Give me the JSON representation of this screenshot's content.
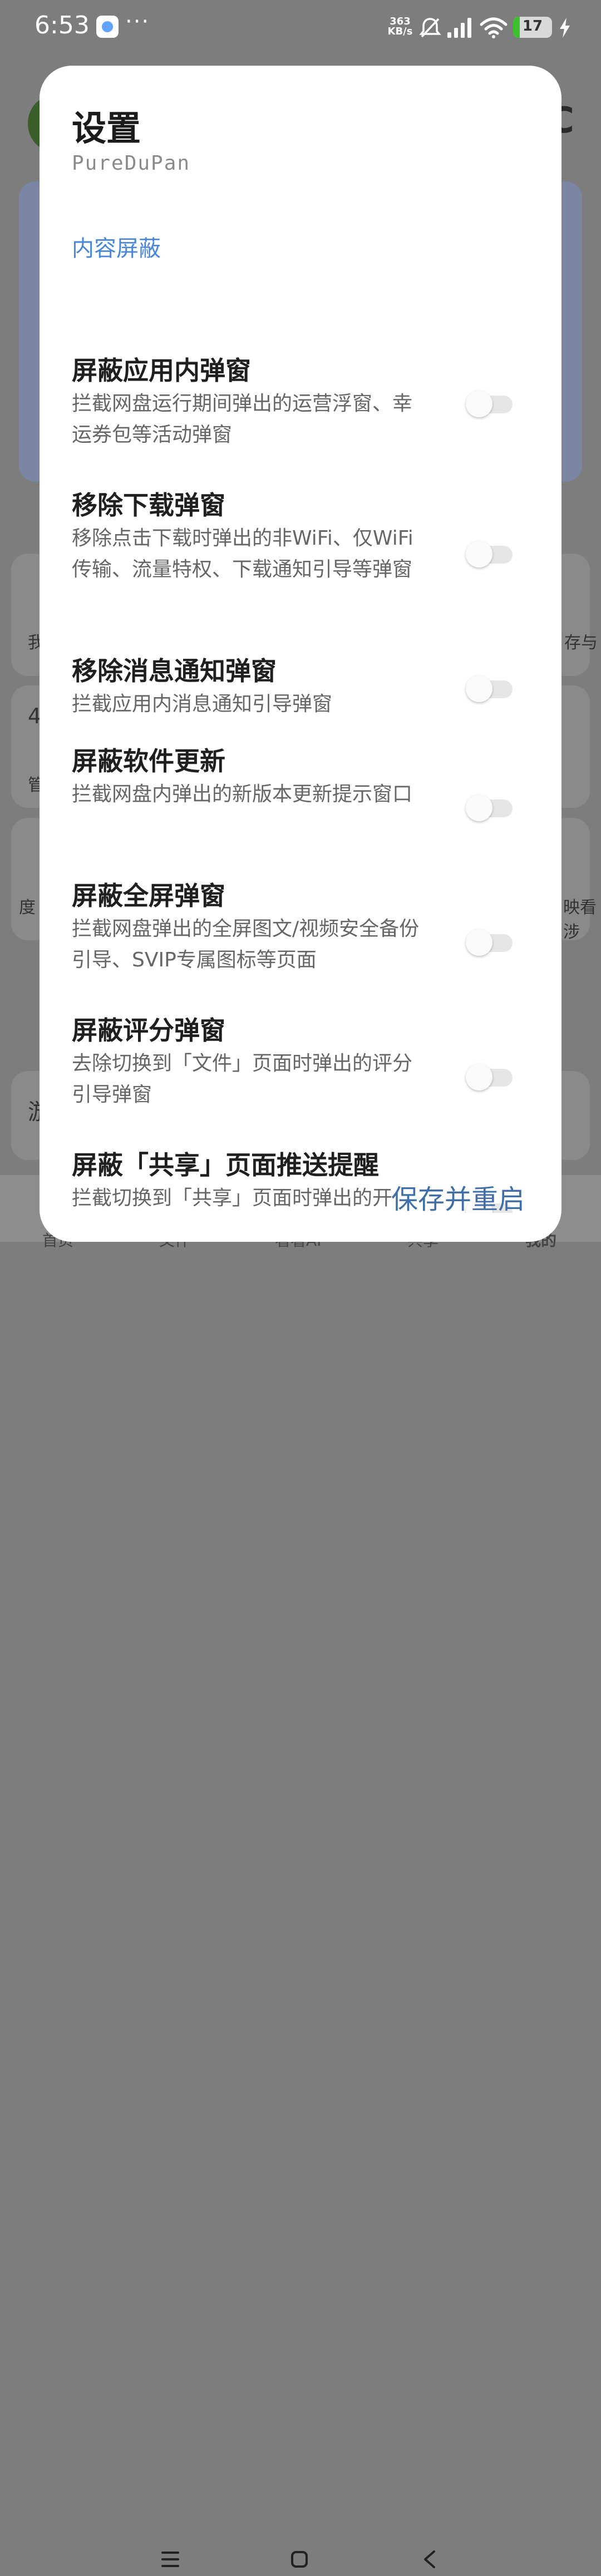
{
  "status_bar": {
    "time": "6:53",
    "more": "···",
    "speed_value": "363",
    "speed_unit": "KB/s",
    "battery": "17",
    "battery_level": 0.17
  },
  "background": {
    "title_fragment": "C",
    "left_fragment_1": "我",
    "right_fragment_1": "存与",
    "left_fragment_2": "4",
    "left_fragment_3": "管",
    "left_fragment_4": "度",
    "right_fragment_4": "映看涉",
    "left_fragment_5": "游",
    "tabs": [
      "首页",
      "文件",
      "看看AI",
      "共享",
      "我的"
    ]
  },
  "dialog": {
    "title": "设置",
    "subtitle": "PureDuPan",
    "section": "内容屏蔽",
    "items": [
      {
        "title": "屏蔽应用内弹窗",
        "desc": "拦截网盘运行期间弹出的运营浮窗、幸运券包等活动弹窗",
        "enabled": false
      },
      {
        "title": "移除下载弹窗",
        "desc": "移除点击下载时弹出的非WiFi、仅WiFi传输、流量特权、下载通知引导等弹窗",
        "enabled": false
      },
      {
        "title": "移除消息通知弹窗",
        "desc": "拦截应用内消息通知引导弹窗",
        "enabled": false
      },
      {
        "title": "屏蔽软件更新",
        "desc": "拦截网盘内弹出的新版本更新提示窗口",
        "enabled": false
      },
      {
        "title": "屏蔽全屏弹窗",
        "desc": "拦截网盘弹出的全屏图文/视频安全备份引导、SVIP专属图标等页面",
        "enabled": false
      },
      {
        "title": "屏蔽评分弹窗",
        "desc": "去除切换到「文件」页面时弹出的评分引导弹窗",
        "enabled": false
      },
      {
        "title": "屏蔽「共享」页面推送提醒",
        "desc": "拦截切换到「共享」页面时弹出的开",
        "enabled": false
      }
    ],
    "action": "保存并重启"
  }
}
